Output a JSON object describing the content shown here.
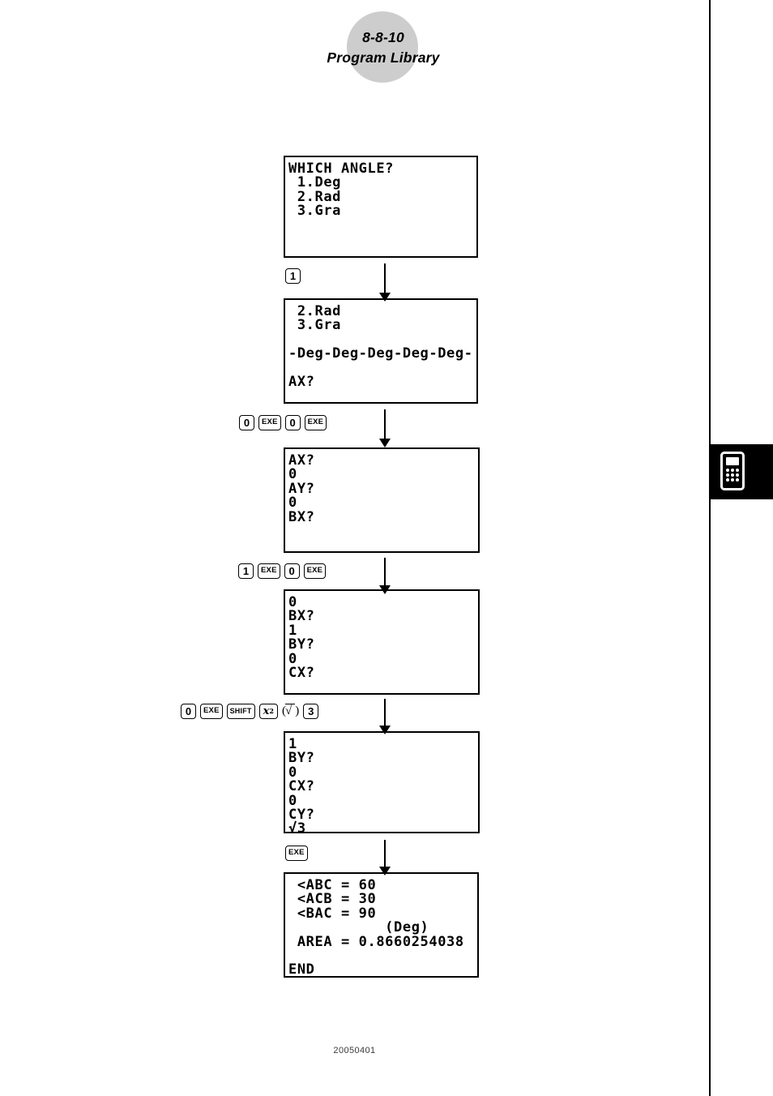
{
  "header": {
    "section_number": "8-8-10",
    "title": "Program Library"
  },
  "sidebar_tab": {
    "icon": "calculator-icon"
  },
  "footer": {
    "date_code": "20050401"
  },
  "flow": {
    "screens": [
      {
        "id": "screen-which-angle",
        "lines": [
          "WHICH ANGLE?",
          " 1.Deg",
          " 2.Rad",
          " 3.Gra",
          "",
          "",
          ""
        ]
      },
      {
        "id": "screen-deg-selected",
        "lines": [
          " 2.Rad",
          " 3.Gra",
          "",
          "-Deg-Deg-Deg-Deg-Deg-",
          "",
          "AX?",
          ""
        ]
      },
      {
        "id": "screen-ax-ay-bx",
        "lines": [
          "AX?",
          "0",
          "AY?",
          "0",
          "BX?",
          "",
          ""
        ]
      },
      {
        "id": "screen-bx-by-cx",
        "lines": [
          "0",
          "BX?",
          "1",
          "BY?",
          "0",
          "CX?",
          ""
        ]
      },
      {
        "id": "screen-by-cx-cy",
        "lines": [
          "1",
          "BY?",
          "0",
          "CX?",
          "0",
          "CY?",
          "√3"
        ]
      },
      {
        "id": "screen-results",
        "lines": [
          " <ABC = 60",
          " <ACB = 30",
          " <BAC = 90",
          "           (Deg)",
          " AREA = 0.8660254038",
          "",
          "END"
        ]
      }
    ],
    "key_sequences": [
      {
        "id": "keys-select-deg",
        "keys": [
          {
            "label": "1",
            "type": "digit"
          }
        ]
      },
      {
        "id": "keys-ax-ay",
        "keys": [
          {
            "label": "0",
            "type": "digit"
          },
          {
            "label": "EXE",
            "type": "exe"
          },
          {
            "label": "0",
            "type": "digit"
          },
          {
            "label": "EXE",
            "type": "exe"
          }
        ]
      },
      {
        "id": "keys-bx-by",
        "keys": [
          {
            "label": "1",
            "type": "digit"
          },
          {
            "label": "EXE",
            "type": "exe"
          },
          {
            "label": "0",
            "type": "digit"
          },
          {
            "label": "EXE",
            "type": "exe"
          }
        ]
      },
      {
        "id": "keys-cx-cy",
        "keys": [
          {
            "label": "0",
            "type": "digit"
          },
          {
            "label": "EXE",
            "type": "exe"
          },
          {
            "label": "SHIFT",
            "type": "shift"
          },
          {
            "label": "x",
            "sup": "2",
            "type": "x2"
          },
          {
            "label": "(√ )",
            "type": "note"
          },
          {
            "label": "3",
            "type": "digit"
          }
        ]
      },
      {
        "id": "keys-execute",
        "keys": [
          {
            "label": "EXE",
            "type": "exe"
          }
        ]
      }
    ]
  }
}
